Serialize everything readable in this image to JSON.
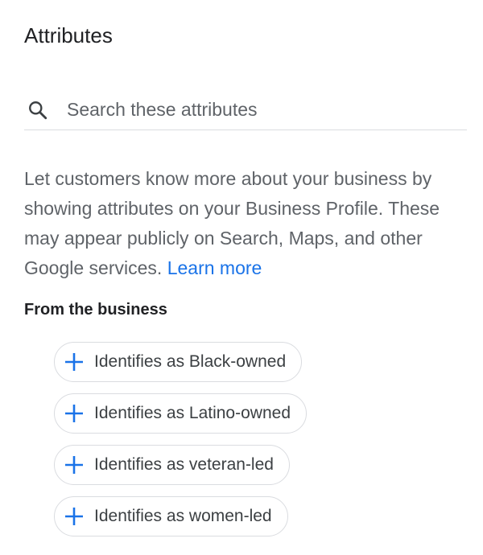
{
  "header": {
    "title": "Attributes"
  },
  "search": {
    "placeholder": "Search these attributes",
    "icon": "search-icon"
  },
  "description": {
    "text": "Let customers know more about your business by showing attributes on your Business Profile. These may appear publicly on Search, Maps, and other Google services.",
    "link_label": "Learn more"
  },
  "section": {
    "heading": "From the business",
    "chips": [
      {
        "label": "Identifies as Black-owned",
        "icon": "plus-icon"
      },
      {
        "label": "Identifies as Latino-owned",
        "icon": "plus-icon"
      },
      {
        "label": "Identifies as veteran-led",
        "icon": "plus-icon"
      },
      {
        "label": "Identifies as women-led",
        "icon": "plus-icon"
      }
    ]
  },
  "colors": {
    "accent": "#1a73e8",
    "text_primary": "#202124",
    "text_secondary": "#5f6368",
    "divider": "#dadce0"
  }
}
